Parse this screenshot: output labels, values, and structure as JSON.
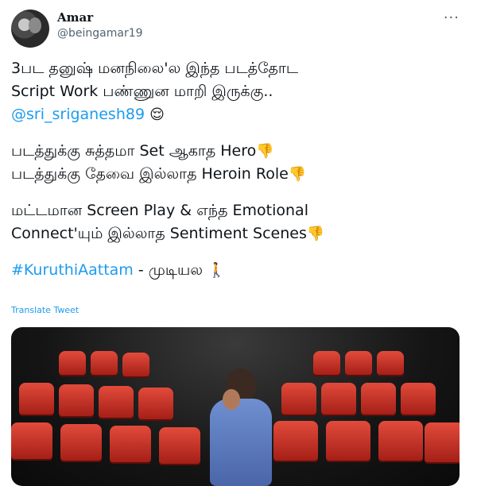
{
  "user": {
    "name": "Amar",
    "handle": "@beingamar19"
  },
  "more_icon": "···",
  "tweet": {
    "line1": "3பட தனுஷ் மனநிலை'ல இந்த படத்தோட",
    "line2": "Script Work பண்ணுன மாறி இருக்கு..",
    "mention": "@sri_sriganesh89",
    "emoji_relieved": "😌",
    "line4": "படத்துக்கு சுத்தமா Set ஆகாத Hero",
    "line5": "படத்துக்கு தேவை இல்லாத Heroin Role",
    "line6": "மட்டமான Screen Play & எந்த Emotional",
    "line7": "Connect'யும் இல்லாத Sentiment Scenes",
    "thumbs_down": "👎",
    "hashtag": "#KuruthiAattam",
    "tail": " - முடியல ",
    "emoji_walk": "🚶"
  },
  "translate_label": "Translate Tweet",
  "colors": {
    "link": "#1d9bf0",
    "text": "#0f1419",
    "muted": "#536471"
  }
}
